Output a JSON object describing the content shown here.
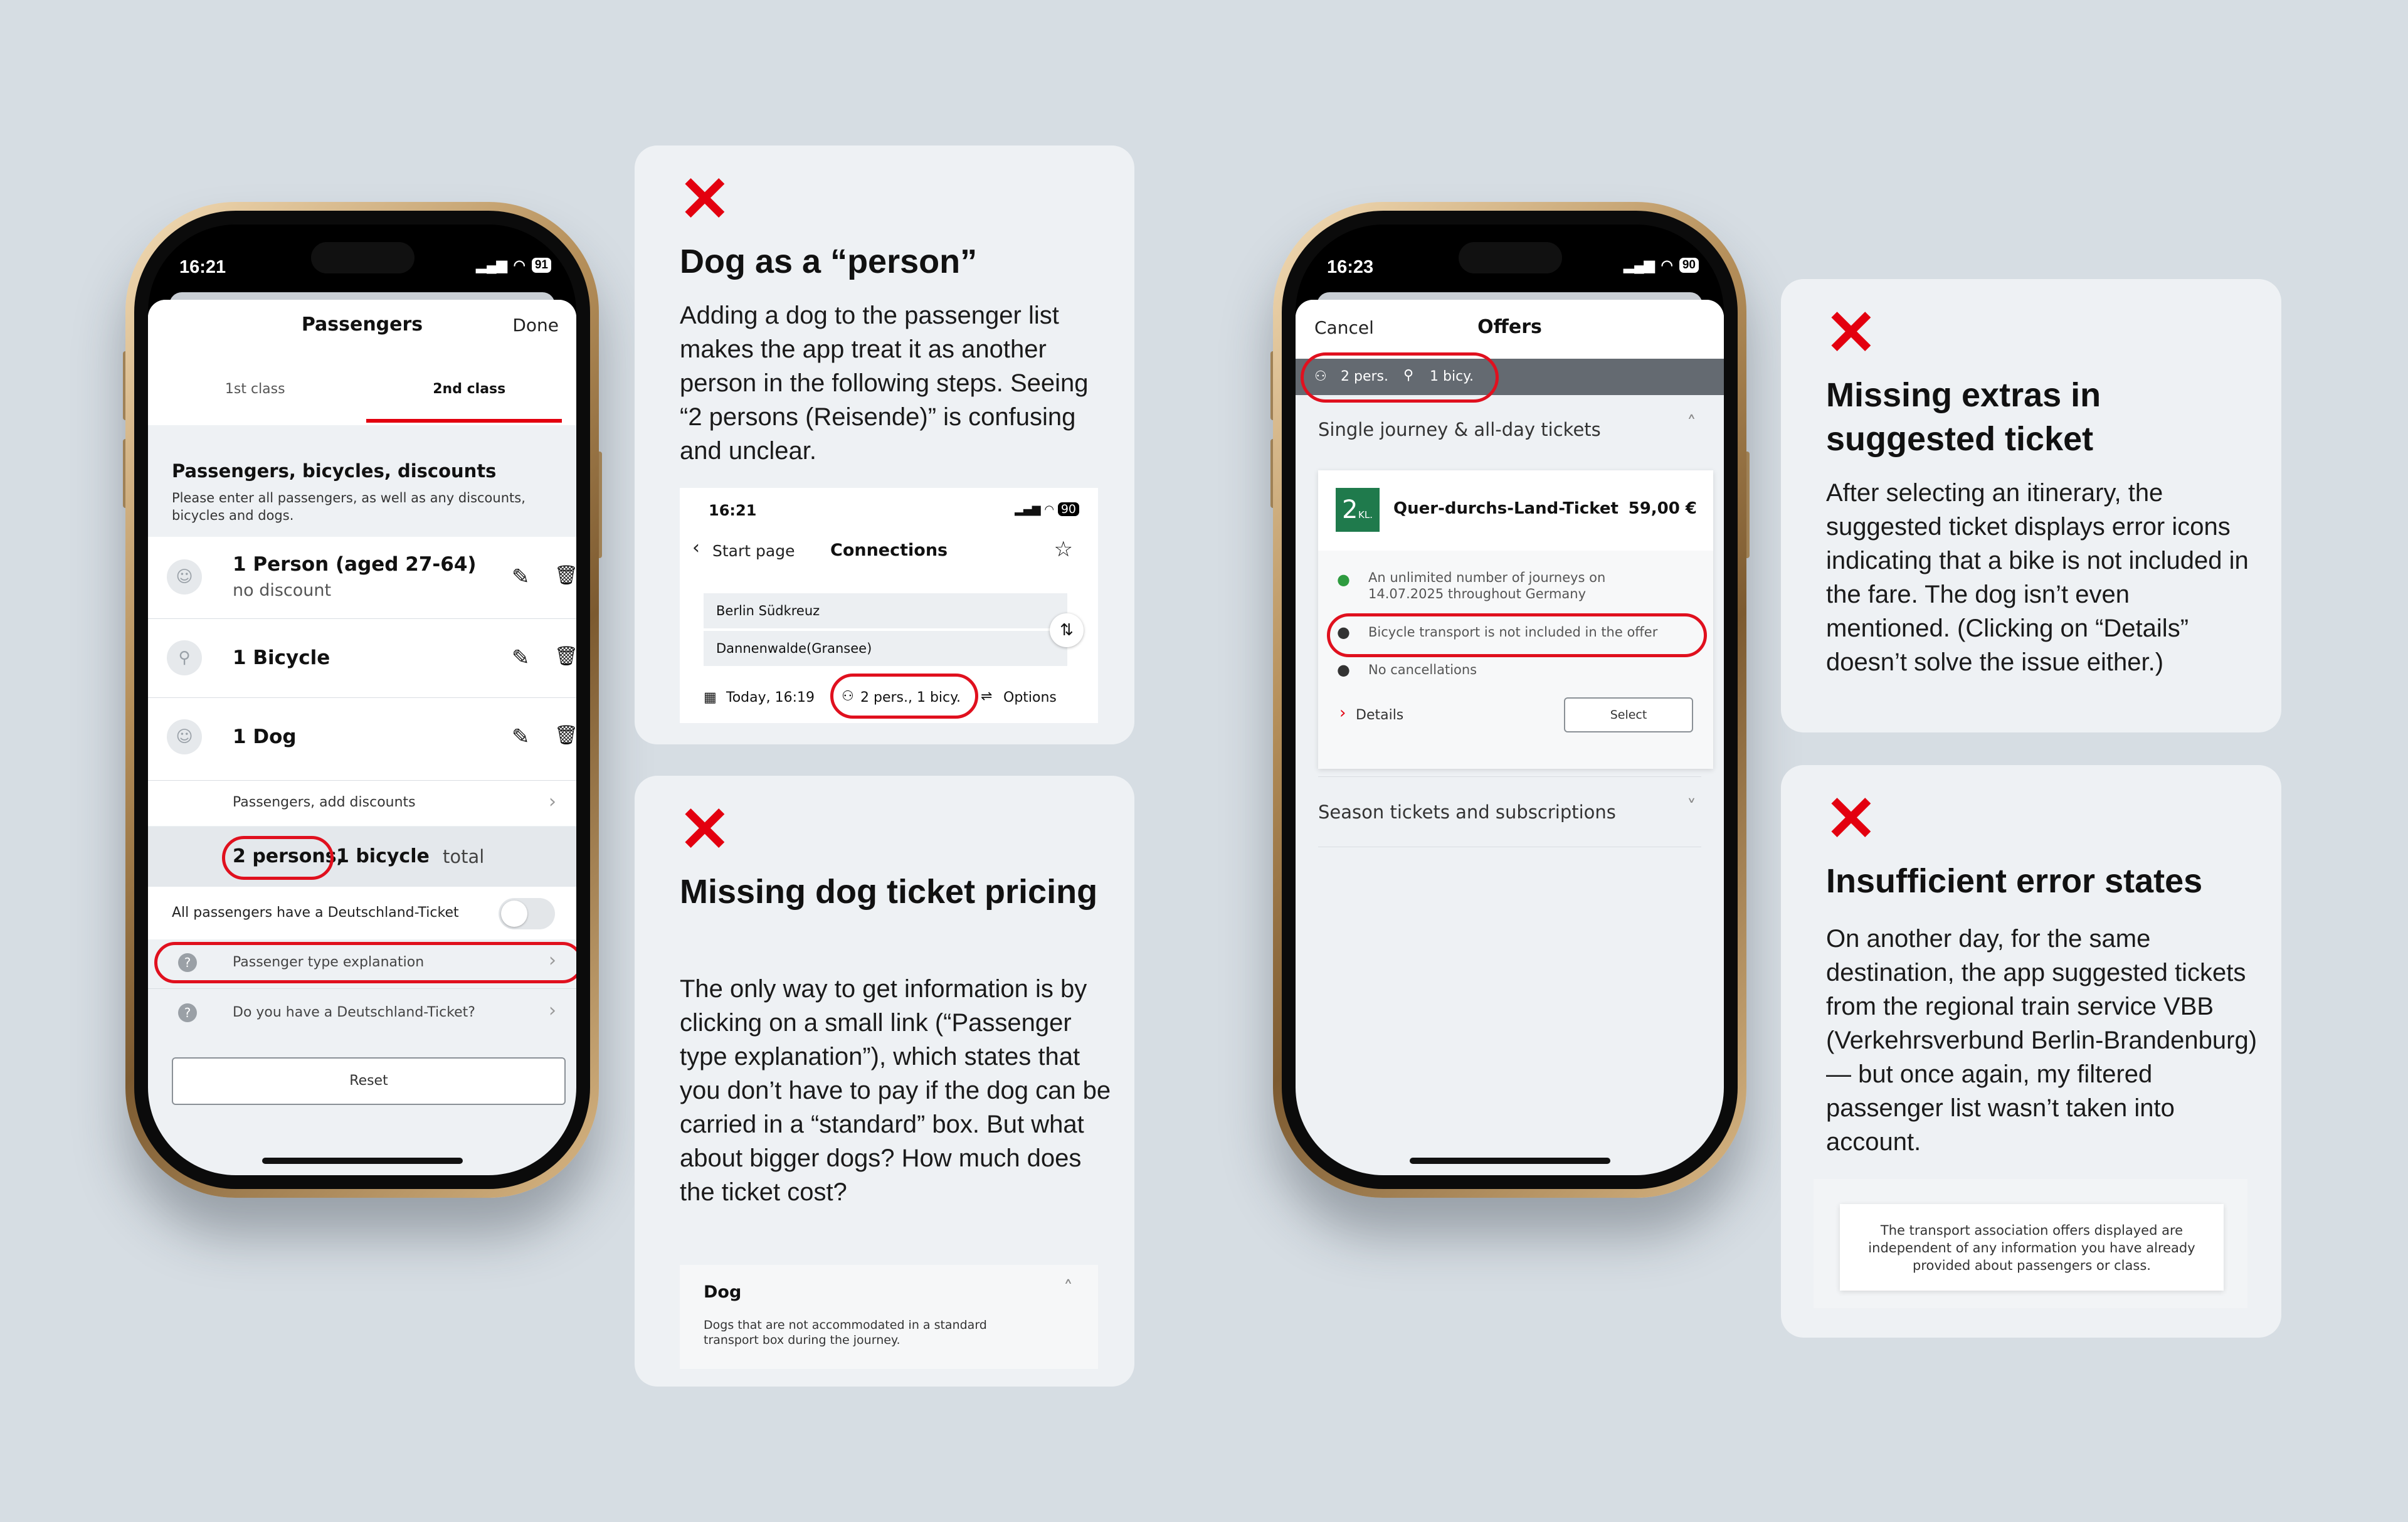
{
  "phone1": {
    "status_time": "16:21",
    "battery": "91",
    "header_title": "Passengers",
    "done_label": "Done",
    "tab_first": "1st class",
    "tab_second": "2nd class",
    "section_title": "Passengers, bicycles, discounts",
    "section_desc": "Please enter all passengers, as well as any discounts, bicycles and dogs.",
    "rows": [
      {
        "title": "1 Person (aged 27-64)",
        "sub": "no discount"
      },
      {
        "title": "1 Bicycle",
        "sub": ""
      },
      {
        "title": "1 Dog",
        "sub": ""
      }
    ],
    "add_discounts": "Passengers, add discounts",
    "total_persons": "2 persons,",
    "total_bicycle": "1 bicycle",
    "total_word": "total",
    "deutschland_toggle": "All passengers have a Deutschland-Ticket",
    "link_explanation": "Passenger type explanation",
    "link_deutschland": "Do you have a Deutschland-Ticket?",
    "reset_label": "Reset"
  },
  "card1": {
    "title": "Dog as a “person”",
    "body": "Adding a dog to the passenger list makes the app treat it as another person in the following steps. Seeing “2 persons (Reisende)” is confusing and unclear.",
    "inset": {
      "time": "16:21",
      "battery": "90",
      "back": "Start page",
      "title": "Connections",
      "from": "Berlin Südkreuz",
      "to": "Dannenwalde(Gransee)",
      "date": "Today, 16:19",
      "pax": "2 pers., 1 bicy.",
      "options": "Options"
    }
  },
  "card2": {
    "title": "Missing dog ticket pricing",
    "body": "The only way to get information is by clicking on a small link (“Passenger type explanation”), which states that you don’t have to pay if the dog can be carried in a “standard” box. But what about bigger dogs? How much does the ticket cost?",
    "inset": {
      "title": "Dog",
      "text": "Dogs that are not accommodated in a standard transport box during the journey."
    }
  },
  "phone2": {
    "status_time": "16:23",
    "battery": "90",
    "cancel": "Cancel",
    "title": "Offers",
    "pax": "2 pers.",
    "bicy": "1 bicy.",
    "section1": "Single journey & all-day tickets",
    "class_badge_num": "2",
    "class_badge_kl": "KL.",
    "ticket_name": "Quer-durchs-Land-Ticket",
    "ticket_price": "59,00 €",
    "info1": "An unlimited number of journeys on 14.07.2025 throughout Germany",
    "info2": "Bicycle transport is not included in the offer",
    "info3": "No cancellations",
    "details": "Details",
    "select": "Select",
    "section2": "Season tickets and subscriptions"
  },
  "card3": {
    "title": "Missing extras in suggested ticket",
    "body": "After selecting an itinerary, the suggested ticket displays error icons indicating that a bike is not included in the fare. The dog isn’t even mentioned. (Clicking on “Details” doesn’t solve the issue either.)"
  },
  "card4": {
    "title": "Insufficient error states",
    "body": "On another day, for the same destination, the app suggested tickets from the regional train service VBB (Verkehrsverbund Berlin-Brandenburg) — but once again, my filtered passenger list wasn’t taken into account.",
    "inset": "The transport association offers displayed are independent of any information you have already provided about passengers or class."
  },
  "colors": {
    "accent_red": "#e3000f",
    "background": "#d6dde3",
    "card": "#eef1f4",
    "db_green": "#1f7a4c"
  }
}
